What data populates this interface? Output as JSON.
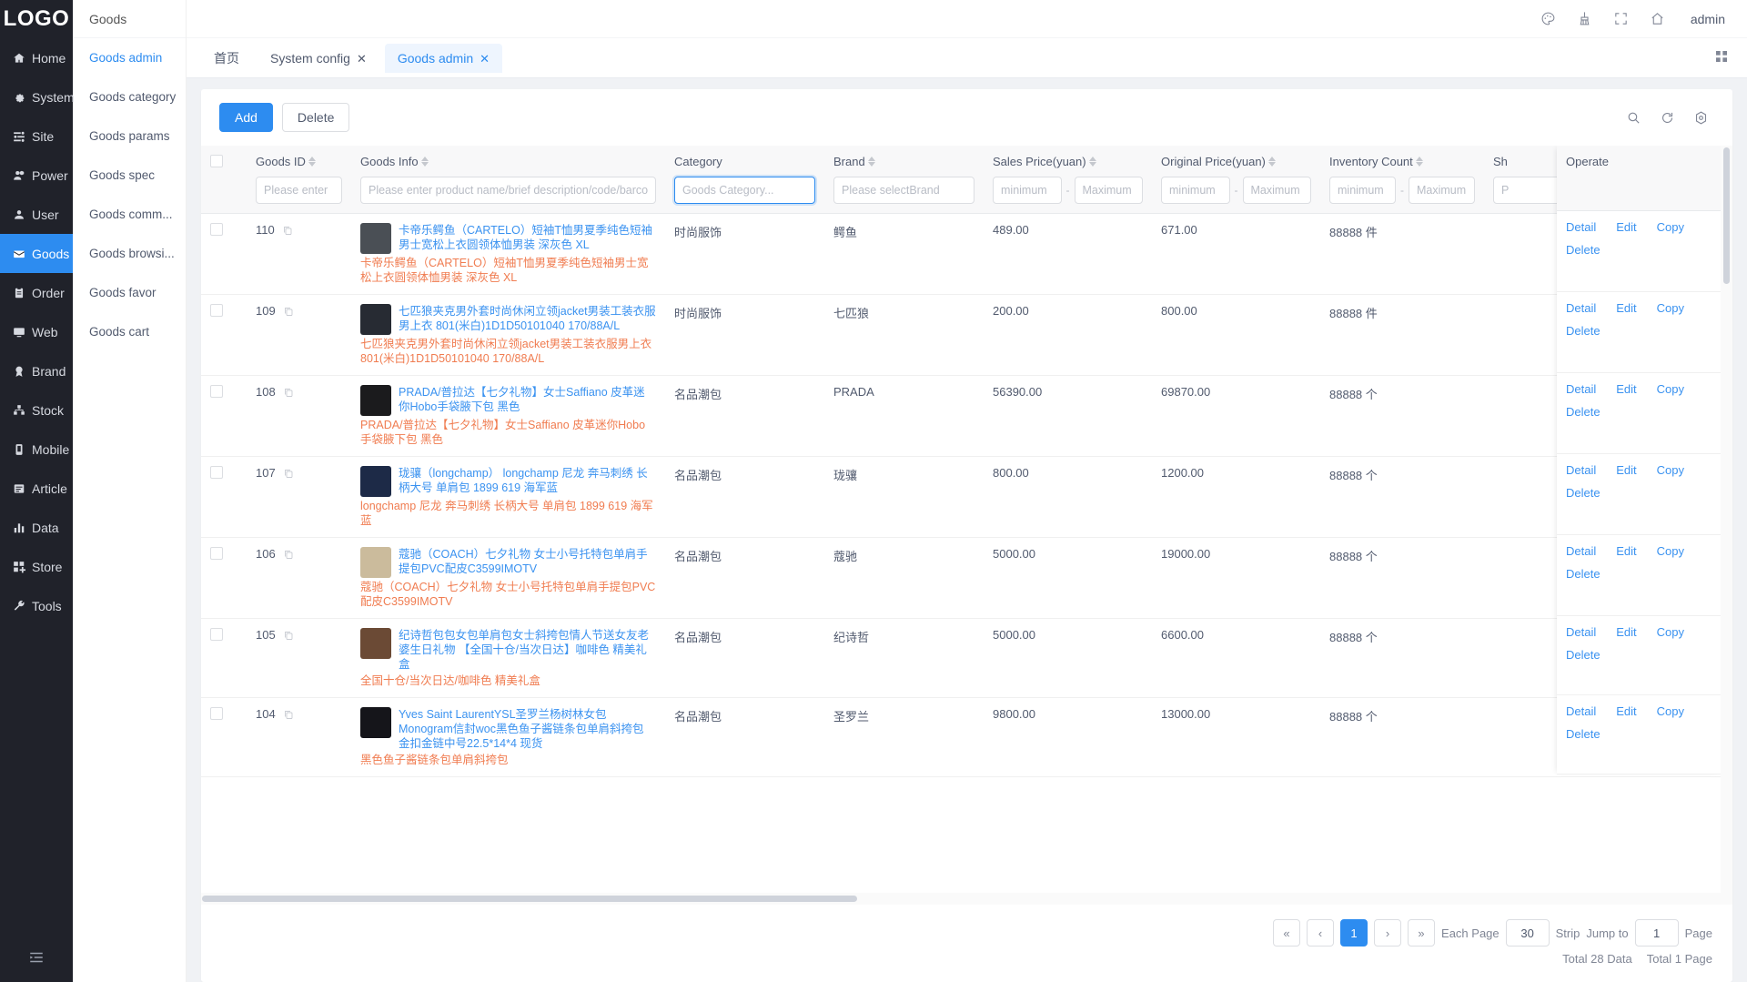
{
  "brand": {
    "logo": "LOGO",
    "accent": "#2d8cf0",
    "sidebar_bg": "#20222a"
  },
  "sidebar_primary": [
    {
      "label": "Home",
      "icon": "home-icon"
    },
    {
      "label": "System",
      "icon": "gear-icon"
    },
    {
      "label": "Site",
      "icon": "site-icon"
    },
    {
      "label": "Power",
      "icon": "power-user-icon"
    },
    {
      "label": "User",
      "icon": "user-icon"
    },
    {
      "label": "Goods",
      "icon": "goods-icon"
    },
    {
      "label": "Order",
      "icon": "order-icon"
    },
    {
      "label": "Web",
      "icon": "web-icon"
    },
    {
      "label": "Brand",
      "icon": "brand-icon"
    },
    {
      "label": "Stock",
      "icon": "stock-icon"
    },
    {
      "label": "Mobile",
      "icon": "mobile-icon"
    },
    {
      "label": "Article",
      "icon": "article-icon"
    },
    {
      "label": "Data",
      "icon": "data-chart-icon"
    },
    {
      "label": "Store",
      "icon": "store-icon"
    },
    {
      "label": "Tools",
      "icon": "tools-wrench-icon"
    }
  ],
  "sidebar_primary_active": "Goods",
  "sidebar_secondary": {
    "title": "Goods",
    "items": [
      {
        "label": "Goods admin"
      },
      {
        "label": "Goods category"
      },
      {
        "label": "Goods params"
      },
      {
        "label": "Goods spec"
      },
      {
        "label": "Goods comm..."
      },
      {
        "label": "Goods browsi..."
      },
      {
        "label": "Goods favor"
      },
      {
        "label": "Goods cart"
      }
    ],
    "active": "Goods admin"
  },
  "topbar": {
    "icons": [
      "palette-icon",
      "broom-icon",
      "fullscreen-icon",
      "home-icon"
    ],
    "user": "admin"
  },
  "tabs": [
    {
      "label": "首页",
      "closable": false,
      "active": false
    },
    {
      "label": "System config",
      "closable": true,
      "active": false
    },
    {
      "label": "Goods admin",
      "closable": true,
      "active": true
    }
  ],
  "toolbar": {
    "add_label": "Add",
    "delete_label": "Delete",
    "icons": [
      "search-icon",
      "refresh-icon",
      "settings-gear-icon"
    ]
  },
  "table": {
    "columns": [
      {
        "key": "check",
        "label": "",
        "sortable": false
      },
      {
        "key": "id",
        "label": "Goods ID",
        "sortable": true,
        "placeholder": "Please enter"
      },
      {
        "key": "info",
        "label": "Goods Info",
        "sortable": true,
        "placeholder": "Please enter product name/brief description/code/barcode"
      },
      {
        "key": "category",
        "label": "Category",
        "sortable": false,
        "placeholder": "Goods Category...",
        "focused": true
      },
      {
        "key": "brand",
        "label": "Brand",
        "sortable": true,
        "placeholder": "Please selectBrand"
      },
      {
        "key": "sales_price",
        "label": "Sales Price(yuan)",
        "sortable": true,
        "placeholder_min": "minimum",
        "placeholder_max": "Maximum"
      },
      {
        "key": "original_price",
        "label": "Original Price(yuan)",
        "sortable": true,
        "placeholder_min": "minimum",
        "placeholder_max": "Maximum"
      },
      {
        "key": "inventory",
        "label": "Inventory Count",
        "sortable": true,
        "placeholder_min": "minimum",
        "placeholder_max": "Maximum"
      },
      {
        "key": "shelf",
        "label": "Sh",
        "sortable": false,
        "placeholder": "P"
      },
      {
        "key": "operate",
        "label": "Operate",
        "sortable": false
      }
    ],
    "rows": [
      {
        "id": "110",
        "name": "卡帝乐鳄鱼（CARTELO）短袖T恤男夏季纯色短袖男士宽松上衣圆领体恤男装 深灰色 XL",
        "desc": "卡帝乐鳄鱼（CARTELO）短袖T恤男夏季纯色短袖男士宽松上衣圆领体恤男装 深灰色 XL",
        "category": "时尚服饰",
        "brand": "鳄鱼",
        "sales_price": "489.00",
        "original_price": "671.00",
        "inventory": "88888 件",
        "thumb": "#4a4f55",
        "operate": [
          "Detail",
          "Edit",
          "Copy",
          "Delete"
        ]
      },
      {
        "id": "109",
        "name": "七匹狼夹克男外套时尚休闲立领jacket男装工装衣服男上衣 801(米白)1D1D50101040 170/88A/L",
        "desc": "七匹狼夹克男外套时尚休闲立领jacket男装工装衣服男上衣 801(米白)1D1D50101040 170/88A/L",
        "category": "时尚服饰",
        "brand": "七匹狼",
        "sales_price": "200.00",
        "original_price": "800.00",
        "inventory": "88888 件",
        "thumb": "#272b33",
        "operate": [
          "Detail",
          "Edit",
          "Copy",
          "Delete"
        ]
      },
      {
        "id": "108",
        "name": "PRADA/普拉达【七夕礼物】女士Saffiano 皮革迷你Hobo手袋腋下包 黑色",
        "desc": "PRADA/普拉达【七夕礼物】女士Saffiano 皮革迷你Hobo手袋腋下包 黑色",
        "category": "名品潮包",
        "brand": "PRADA",
        "sales_price": "56390.00",
        "original_price": "69870.00",
        "inventory": "88888 个",
        "thumb": "#1b1b1d",
        "operate": [
          "Detail",
          "Edit",
          "Copy",
          "Delete"
        ]
      },
      {
        "id": "107",
        "name": "珑骧（longchamp） longchamp 尼龙 奔马刺绣 长柄大号 单肩包 1899 619 海军蓝",
        "desc": "longchamp 尼龙 奔马刺绣 长柄大号 单肩包 1899 619 海军蓝",
        "category": "名品潮包",
        "brand": "珑骧",
        "sales_price": "800.00",
        "original_price": "1200.00",
        "inventory": "88888 个",
        "thumb": "#1d2a47",
        "operate": [
          "Detail",
          "Edit",
          "Copy",
          "Delete"
        ]
      },
      {
        "id": "106",
        "name": "蔻驰（COACH）七夕礼物 女士小号托特包单肩手提包PVC配皮C3599IMOTV",
        "desc": "蔻驰（COACH）七夕礼物 女士小号托特包单肩手提包PVC配皮C3599IMOTV",
        "category": "名品潮包",
        "brand": "蔻驰",
        "sales_price": "5000.00",
        "original_price": "19000.00",
        "inventory": "88888 个",
        "thumb": "#cbbb9c",
        "operate": [
          "Detail",
          "Edit",
          "Copy",
          "Delete"
        ]
      },
      {
        "id": "105",
        "name": "纪诗哲包包女包单肩包女士斜挎包情人节送女友老婆生日礼物 【全国十仓/当次日达】咖啡色 精美礼盒",
        "desc": "全国十仓/当次日达/咖啡色 精美礼盒",
        "category": "名品潮包",
        "brand": "纪诗哲",
        "sales_price": "5000.00",
        "original_price": "6600.00",
        "inventory": "88888 个",
        "thumb": "#6b4a35",
        "operate": [
          "Detail",
          "Edit",
          "Copy",
          "Delete"
        ]
      },
      {
        "id": "104",
        "name": "Yves Saint LaurentYSL圣罗兰杨树林女包Monogram信封woc黑色鱼子酱链条包单肩斜挎包 金扣金链中号22.5*14*4 现货",
        "desc": "黑色鱼子酱链条包单肩斜挎包",
        "category": "名品潮包",
        "brand": "圣罗兰",
        "sales_price": "9800.00",
        "original_price": "13000.00",
        "inventory": "88888 个",
        "thumb": "#15151a",
        "operate": [
          "Detail",
          "Edit",
          "Copy",
          "Delete"
        ]
      }
    ]
  },
  "pagination": {
    "first": "«",
    "prev": "‹",
    "pages": [
      "1"
    ],
    "current": "1",
    "next": "›",
    "last": "»",
    "each_page_label": "Each Page",
    "page_size": "30",
    "strip_label": "Strip",
    "jump_label": "Jump to",
    "jump_value": "1",
    "page_label": "Page",
    "total_data": "Total 28 Data",
    "total_pages": "Total 1 Page"
  }
}
